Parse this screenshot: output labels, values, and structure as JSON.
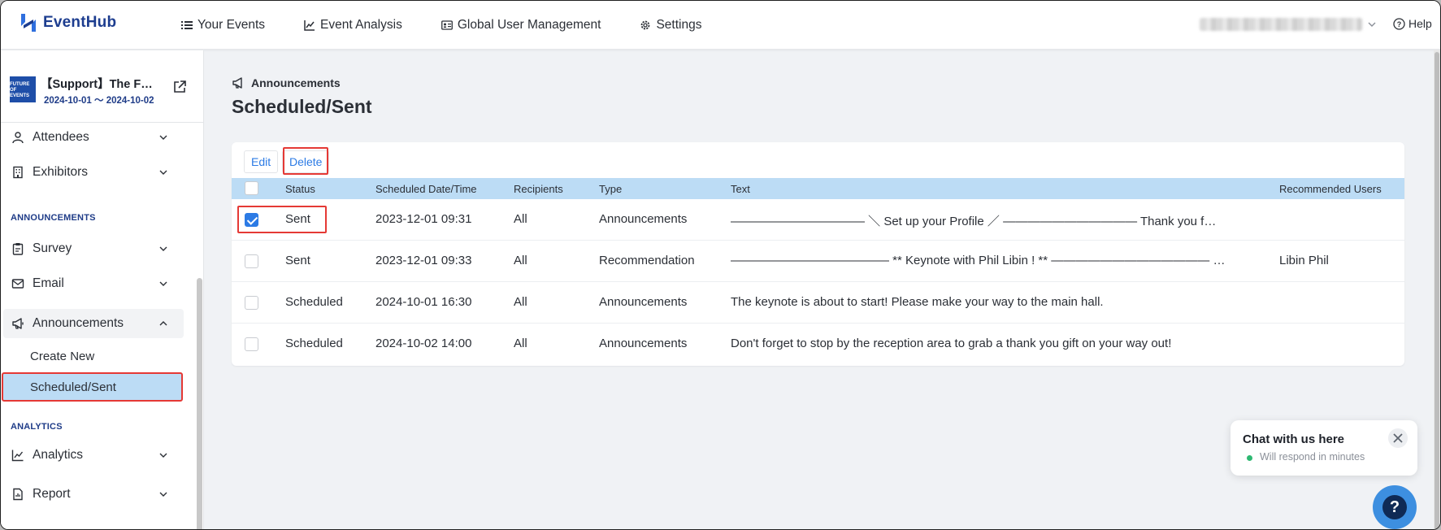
{
  "app": {
    "name": "EventHub"
  },
  "topnav": {
    "items": [
      {
        "label": "Your Events",
        "icon": "list-icon"
      },
      {
        "label": "Event Analysis",
        "icon": "chart-icon"
      },
      {
        "label": "Global User Management",
        "icon": "id-card-icon"
      },
      {
        "label": "Settings",
        "icon": "gear-icon"
      }
    ],
    "help_label": "Help"
  },
  "event": {
    "title": "【Support】The F…",
    "dates": "2024-10-01 ～ 2024-10-02",
    "logo_text": "FUTURE OF EVENTS"
  },
  "sidebar": {
    "items": {
      "attendees": "Attendees",
      "exhibitors": "Exhibitors",
      "survey": "Survey",
      "email": "Email",
      "announcements": "Announcements",
      "analytics": "Analytics",
      "report": "Report"
    },
    "sections": {
      "announcements": "ANNOUNCEMENTS",
      "analytics": "ANALYTICS"
    },
    "sub_items": {
      "create_new": "Create New",
      "scheduled_sent": "Scheduled/Sent"
    }
  },
  "main": {
    "breadcrumb": "Announcements",
    "title": "Scheduled/Sent",
    "buttons": {
      "edit": "Edit",
      "delete": "Delete"
    },
    "columns": {
      "status": "Status",
      "scheduled": "Scheduled Date/Time",
      "recipients": "Recipients",
      "type": "Type",
      "text": "Text",
      "recommended": "Recommended Users"
    },
    "rows": [
      {
        "checked": true,
        "status": "Sent",
        "datetime": "2023-12-01 09:31",
        "recipients": "All",
        "type": "Announcements",
        "text": "――――――――――― ＼ Set up your Profile ／ ――――――――――― Thank you f…",
        "recommended": ""
      },
      {
        "checked": false,
        "status": "Sent",
        "datetime": "2023-12-01 09:33",
        "recipients": "All",
        "type": "Recommendation",
        "text": "――――――――――――― ** Keynote with Phil Libin ! ** ――――――――――――― …",
        "recommended": "Libin Phil"
      },
      {
        "checked": false,
        "status": "Scheduled",
        "datetime": "2024-10-01 16:30",
        "recipients": "All",
        "type": "Announcements",
        "text": "The keynote is about to start! Please make your way to the main hall.",
        "recommended": ""
      },
      {
        "checked": false,
        "status": "Scheduled",
        "datetime": "2024-10-02 14:00",
        "recipients": "All",
        "type": "Announcements",
        "text": "Don't forget to stop by the reception area to grab a thank you gift on your way out!",
        "recommended": ""
      }
    ]
  },
  "chat": {
    "title": "Chat with us here",
    "subtitle": "Will respond in minutes",
    "bubble": "?"
  },
  "colors": {
    "accent": "#2c7be5",
    "highlight_box": "#e53935",
    "header_row": "#bcdcf5",
    "brand": "#1d3d8f"
  }
}
